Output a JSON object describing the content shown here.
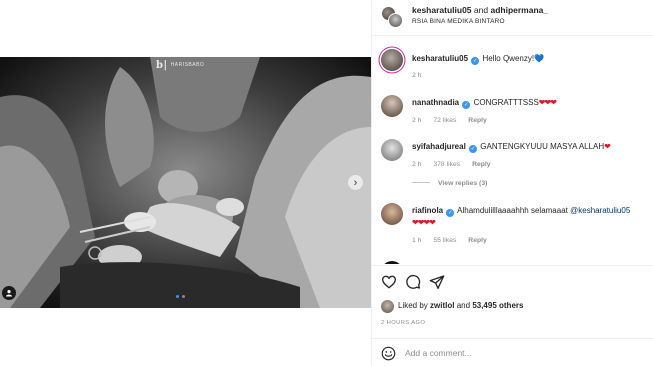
{
  "post": {
    "header": {
      "user1": "kesharatuliu05",
      "joiner": "and",
      "user2": "adhipermana_",
      "location": "RSIA BINA MEDIKA BINTARO"
    },
    "watermark": "HARISBABO",
    "carousel": {
      "total": 2,
      "current": 1
    },
    "comments": [
      {
        "user": "kesharatuliu05",
        "verified": true,
        "text": "Hello Qwenzy!",
        "emoji": "💙",
        "time": "2 h"
      },
      {
        "user": "nanathnadia",
        "verified": true,
        "text": "CONGRATTTSSS",
        "hearts": "❤❤❤",
        "time": "2 h",
        "likes": "72 likes",
        "reply": "Reply"
      },
      {
        "user": "syifahadjureal",
        "verified": true,
        "text": "GANTENGKYUUU MASYA ALLAH",
        "hearts": "❤",
        "time": "2 h",
        "likes": "378 likes",
        "reply": "Reply",
        "view_replies": "View replies (3)"
      },
      {
        "user": "riafinola",
        "verified": true,
        "text": "Alhamdulilllaaaahhh selamaaat",
        "mention": "@kesharatuliu05",
        "hearts": "❤❤❤❤",
        "time": "1 h",
        "likes": "55 likes",
        "reply": "Reply"
      }
    ],
    "likes_row": {
      "prefix": "Liked by",
      "user": "zwitlol",
      "and": "and",
      "others": "53,495 others"
    },
    "posted_ago": "2 HOURS AGO",
    "comment_input": {
      "placeholder": "Add a comment..."
    },
    "icons": {
      "like": "heart-icon",
      "comment": "comment-icon",
      "share": "share-icon",
      "next": "chevron-right-icon",
      "tag": "person-tag-icon",
      "emoji": "emoji-icon"
    },
    "colors": {
      "verified": "#3897f0",
      "heart": "#e0162b",
      "muted": "#8e8e8e"
    }
  }
}
